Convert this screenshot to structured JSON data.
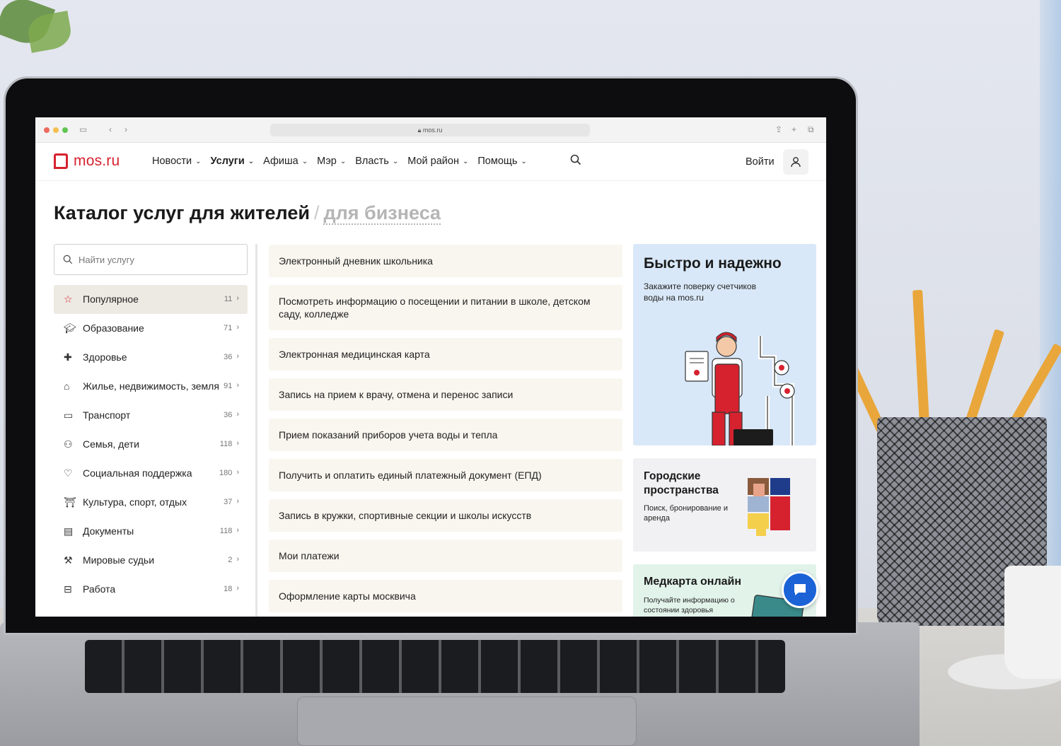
{
  "browser": {
    "url": "mos.ru"
  },
  "header": {
    "logo": "mos.ru",
    "nav": [
      {
        "label": "Новости",
        "bold": false
      },
      {
        "label": "Услуги",
        "bold": true
      },
      {
        "label": "Афиша",
        "bold": false
      },
      {
        "label": "Мэр",
        "bold": false
      },
      {
        "label": "Власть",
        "bold": false
      },
      {
        "label": "Мой район",
        "bold": false
      },
      {
        "label": "Помощь",
        "bold": false
      }
    ],
    "login_label": "Войти"
  },
  "page": {
    "title": "Каталог услуг для жителей",
    "separator": "/",
    "alt_title": "для бизнеса"
  },
  "search": {
    "placeholder": "Найти услугу"
  },
  "categories": [
    {
      "label": "Популярное",
      "count": "11",
      "icon": "star-icon",
      "active": true
    },
    {
      "label": "Образование",
      "count": "71",
      "icon": "graduation-cap-icon"
    },
    {
      "label": "Здоровье",
      "count": "36",
      "icon": "medical-cross-icon"
    },
    {
      "label": "Жилье, недвижимость, земля",
      "count": "91",
      "icon": "house-icon"
    },
    {
      "label": "Транспорт",
      "count": "36",
      "icon": "bus-icon"
    },
    {
      "label": "Семья, дети",
      "count": "118",
      "icon": "family-icon"
    },
    {
      "label": "Социальная поддержка",
      "count": "180",
      "icon": "heart-icon"
    },
    {
      "label": "Культура, спорт, отдых",
      "count": "37",
      "icon": "museum-icon"
    },
    {
      "label": "Документы",
      "count": "118",
      "icon": "document-icon"
    },
    {
      "label": "Мировые судьи",
      "count": "2",
      "icon": "gavel-icon"
    },
    {
      "label": "Работа",
      "count": "18",
      "icon": "briefcase-icon"
    }
  ],
  "services": [
    "Электронный дневник школьника",
    "Посмотреть информацию о посещении и питании в школе, детском саду, колледже",
    "Электронная медицинская карта",
    "Запись на прием к врачу, отмена и перенос записи",
    "Прием показаний приборов учета воды и тепла",
    "Получить и оплатить единый платежный документ (ЕПД)",
    "Запись в кружки, спортивные секции и школы искусств",
    "Мои платежи",
    "Оформление карты москвича"
  ],
  "promos": {
    "water": {
      "title": "Быстро и надежно",
      "subtitle": "Закажите поверку счетчиков воды на mos.ru"
    },
    "spaces": {
      "title": "Городские пространства",
      "subtitle": "Поиск, бронирование и аренда"
    },
    "medcard": {
      "title": "Медкарта онлайн",
      "subtitle": "Получайте информацию о состоянии здоровья"
    }
  },
  "colors": {
    "brand_red": "#d6222f",
    "service_bg": "#f8f6ef",
    "chat_blue": "#1a62d6"
  }
}
